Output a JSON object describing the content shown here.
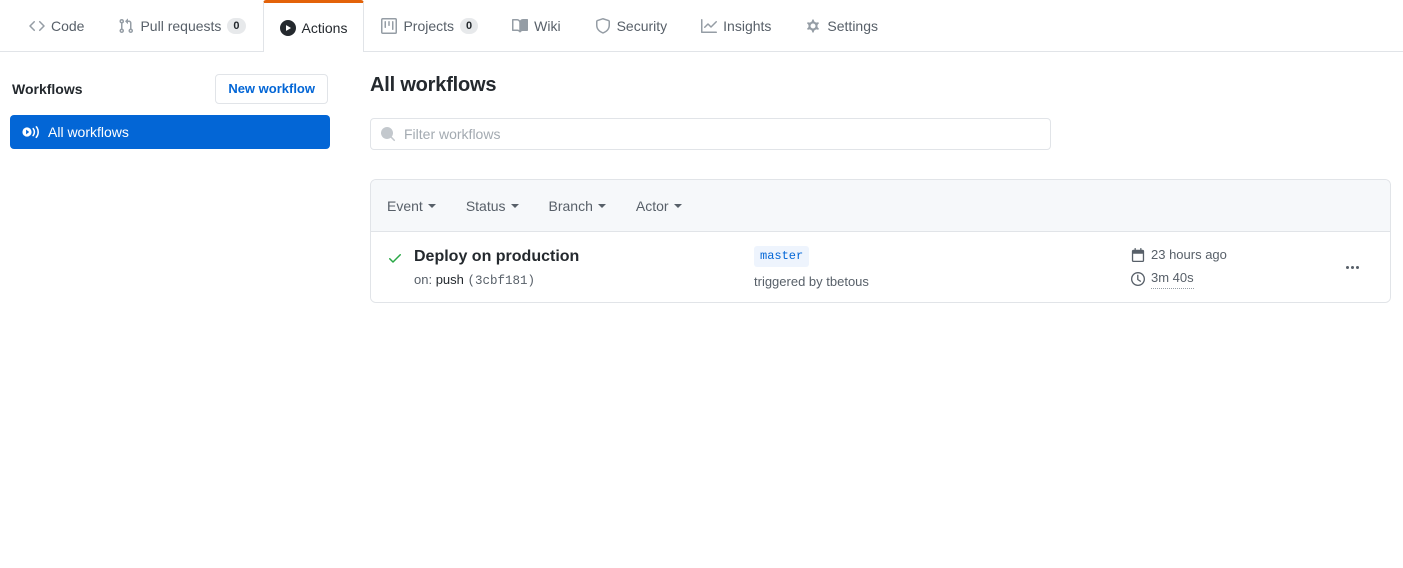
{
  "repo_nav": {
    "tabs": [
      {
        "label": "Code",
        "icon": "code-icon",
        "count": null,
        "selected": false
      },
      {
        "label": "Pull requests",
        "icon": "git-pull-request-icon",
        "count": "0",
        "selected": false
      },
      {
        "label": "Actions",
        "icon": "play-icon",
        "count": null,
        "selected": true
      },
      {
        "label": "Projects",
        "icon": "project-icon",
        "count": "0",
        "selected": false
      },
      {
        "label": "Wiki",
        "icon": "book-icon",
        "count": null,
        "selected": false
      },
      {
        "label": "Security",
        "icon": "shield-icon",
        "count": null,
        "selected": false
      },
      {
        "label": "Insights",
        "icon": "graph-icon",
        "count": null,
        "selected": false
      },
      {
        "label": "Settings",
        "icon": "gear-icon",
        "count": null,
        "selected": false
      }
    ],
    "selected_accent": "#e36209"
  },
  "sidebar": {
    "title": "Workflows",
    "new_workflow_label": "New workflow",
    "items": [
      {
        "label": "All workflows",
        "icon": "workflow-broadcast-icon",
        "selected": true
      }
    ],
    "selected_bg": "#0366d6"
  },
  "main": {
    "page_title": "All workflows",
    "filter": {
      "placeholder": "Filter workflows",
      "value": "",
      "icon": "search-icon"
    },
    "table": {
      "filters": [
        {
          "label": "Event"
        },
        {
          "label": "Status"
        },
        {
          "label": "Branch"
        },
        {
          "label": "Actor"
        }
      ],
      "rows": [
        {
          "status_icon": "check-icon",
          "status_color": "#28a745",
          "title": "Deploy on production",
          "on_prefix": "on:",
          "event": "push",
          "commit_sha": "(3cbf181)",
          "branch": "master",
          "triggered_by": "triggered by tbetous",
          "time_ago": "23 hours ago",
          "time_icon": "calendar-icon",
          "duration": "3m 40s",
          "duration_icon": "clock-icon",
          "menu_icon": "kebab-horizontal-icon"
        }
      ]
    }
  }
}
